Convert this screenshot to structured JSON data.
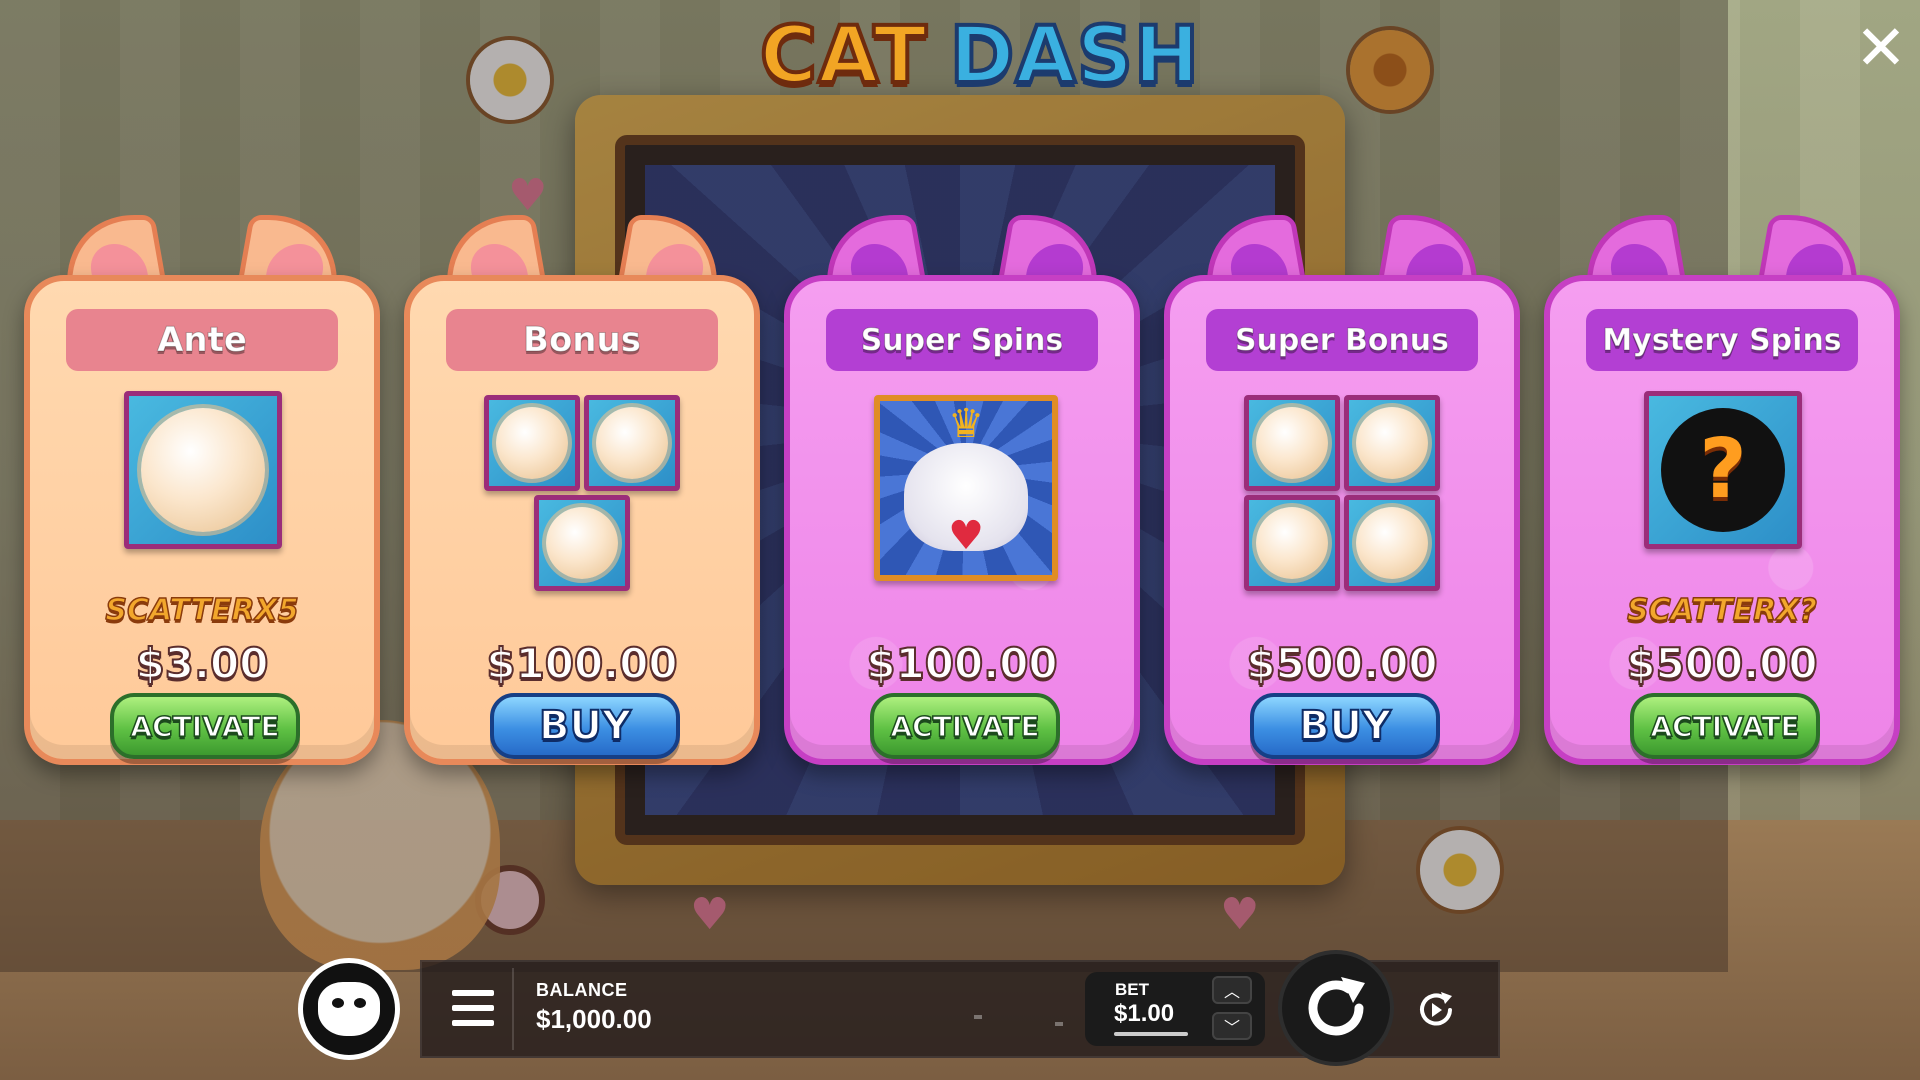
{
  "game": {
    "title_word1": "CAT",
    "title_word2": "DASH"
  },
  "close_label": "✕",
  "cards": [
    {
      "id": "ante",
      "theme": "orange",
      "title": "Ante",
      "symbol": "scatter-fluff-ball",
      "symbol_count": 1,
      "subtitle": "SCATTERX5",
      "price": "$3.00",
      "button": "ACTIVATE",
      "button_type": "activate"
    },
    {
      "id": "bonus",
      "theme": "orange",
      "title": "Bonus",
      "symbol": "scatter-fluff-ball",
      "symbol_count": 3,
      "subtitle": "",
      "price": "$100.00",
      "button": "BUY",
      "button_type": "buy"
    },
    {
      "id": "super-spins",
      "theme": "pink",
      "title": "Super Spins",
      "symbol": "king-cat",
      "symbol_count": 1,
      "subtitle": "",
      "price": "$100.00",
      "button": "ACTIVATE",
      "button_type": "activate"
    },
    {
      "id": "super-bonus",
      "theme": "pink",
      "title": "Super Bonus",
      "symbol": "scatter-fluff-ball",
      "symbol_count": 4,
      "subtitle": "",
      "price": "$500.00",
      "button": "BUY",
      "button_type": "buy"
    },
    {
      "id": "mystery-spins",
      "theme": "pink",
      "title": "Mystery Spins",
      "symbol": "mystery-ball",
      "symbol_count": 1,
      "mystery_glyph": "?",
      "subtitle": "SCATTERX?",
      "price": "$500.00",
      "button": "ACTIVATE",
      "button_type": "activate"
    }
  ],
  "bottom_bar": {
    "menu_icon": "hamburger-menu-icon",
    "balance_label": "BALANCE",
    "balance_value": "$1,000.00",
    "bet_label": "BET",
    "bet_value": "$1.00",
    "bet_up_glyph": "︿",
    "bet_down_glyph": "﹀",
    "spin_icon": "spin-arrow-icon",
    "autoplay_icon": "autoplay-icon"
  },
  "colors": {
    "orange_card": "#ffd2a6",
    "pink_card": "#f28fec",
    "activate_green": "#5fc144",
    "buy_blue": "#3c8fe3",
    "scatter_text": "#f2a72c"
  }
}
